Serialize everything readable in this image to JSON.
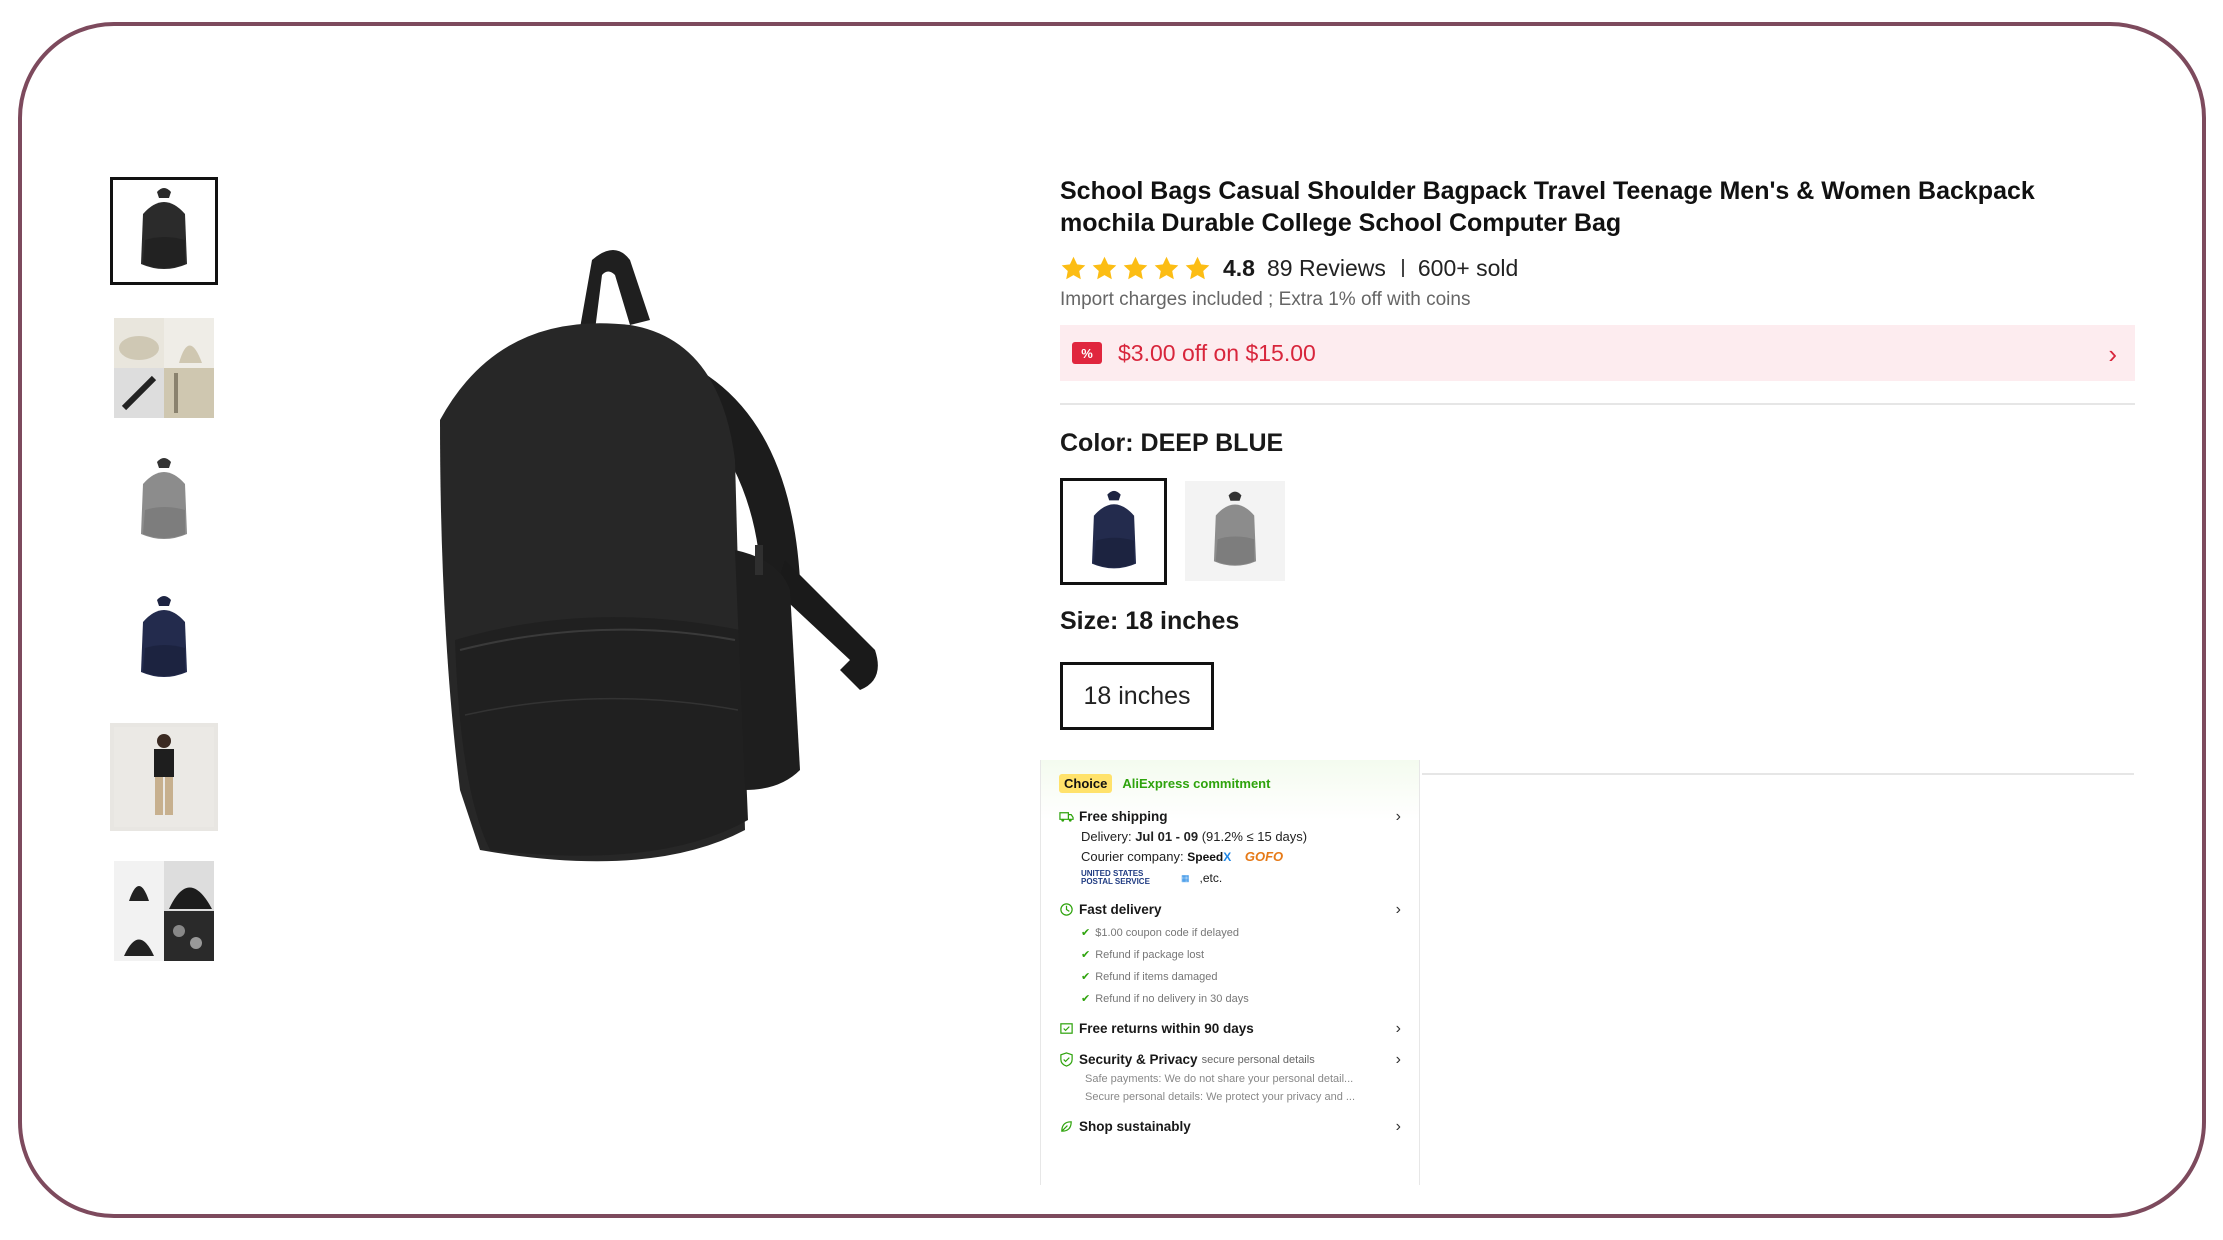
{
  "product": {
    "title": "School Bags Casual Shoulder Bagpack Travel Teenage Men's & Women Backpack mochila Durable College School Computer Bag",
    "rating": "4.8",
    "reviews": "89 Reviews",
    "sold": "600+ sold",
    "import_note": "Import charges included ; Extra 1% off with coins"
  },
  "coupon": {
    "icon": "%",
    "text": "$3.00 off on $15.00"
  },
  "color": {
    "label": "Color: DEEP BLUE",
    "options": [
      "deep-blue",
      "gray"
    ]
  },
  "size": {
    "label": "Size: 18 inches",
    "option": "18 inches"
  },
  "thumbnails": [
    "black-backpack",
    "beige-collage",
    "gray-backpack",
    "navy-backpack",
    "model-wearing",
    "black-collage"
  ],
  "choice": {
    "badge": "Choice",
    "commitment": "AliExpress commitment",
    "free_shipping": "Free shipping",
    "delivery_label": "Delivery:",
    "delivery_dates": "Jul 01 - 09",
    "delivery_rate": "(91.2% ≤ 15 days)",
    "courier_label": "Courier company:",
    "courier_speedx_a": "Speed",
    "courier_speedx_b": "X",
    "courier_gofo": "GOFO",
    "courier_usps": "UNITED STATES POSTAL SERVICE",
    "courier_etc": ",etc.",
    "fast_delivery": "Fast delivery",
    "fast_items": [
      "$1.00 coupon code if delayed",
      "Refund if package lost",
      "Refund if items damaged",
      "Refund if no delivery in 30 days"
    ],
    "free_returns": "Free returns within 90 days",
    "security": "Security & Privacy",
    "security_sub": "secure personal details",
    "security_lines": [
      "Safe payments: We do not share your personal detail...",
      "Secure personal details: We protect your privacy and ..."
    ],
    "sustain": "Shop sustainably"
  },
  "colors": {
    "accent": "#d8263c",
    "choice_green": "#2ea30c",
    "frame": "#7d4a5d"
  }
}
